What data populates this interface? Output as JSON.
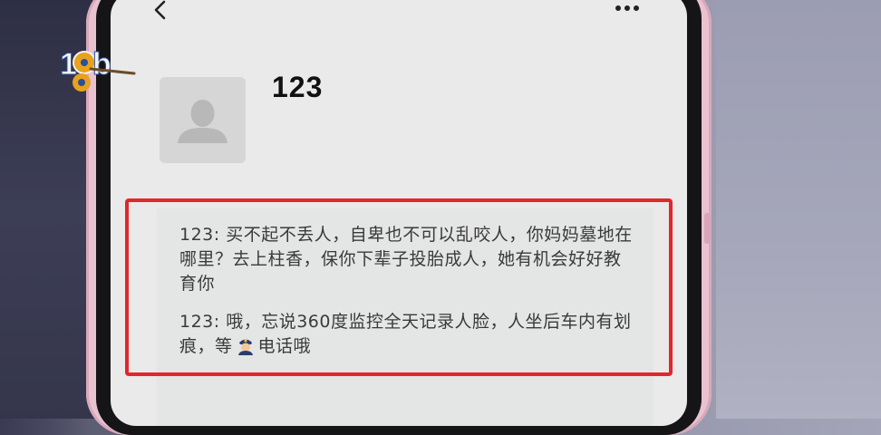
{
  "header": {
    "back_icon": "chevron-left-icon",
    "more_icon": "ellipsis-icon"
  },
  "contact": {
    "avatar_icon": "default-avatar-icon",
    "name": "123"
  },
  "messages": [
    {
      "text": "123: 买不起不丢人，自卑也不可以乱咬人，你妈妈墓地在哪里？去上柱香，保你下辈子投胎成人，她有机会好好教育你"
    },
    {
      "text_before": "123: 哦，忘说360度监控全天记录人脸，人坐后车内有划痕，等",
      "emoji": "police-officer-emoji",
      "text_after": "电话哦"
    }
  ],
  "highlight": {
    "color": "#e2262a"
  },
  "watermark": {
    "text": "18",
    "icon": "channel-logo-icon"
  }
}
